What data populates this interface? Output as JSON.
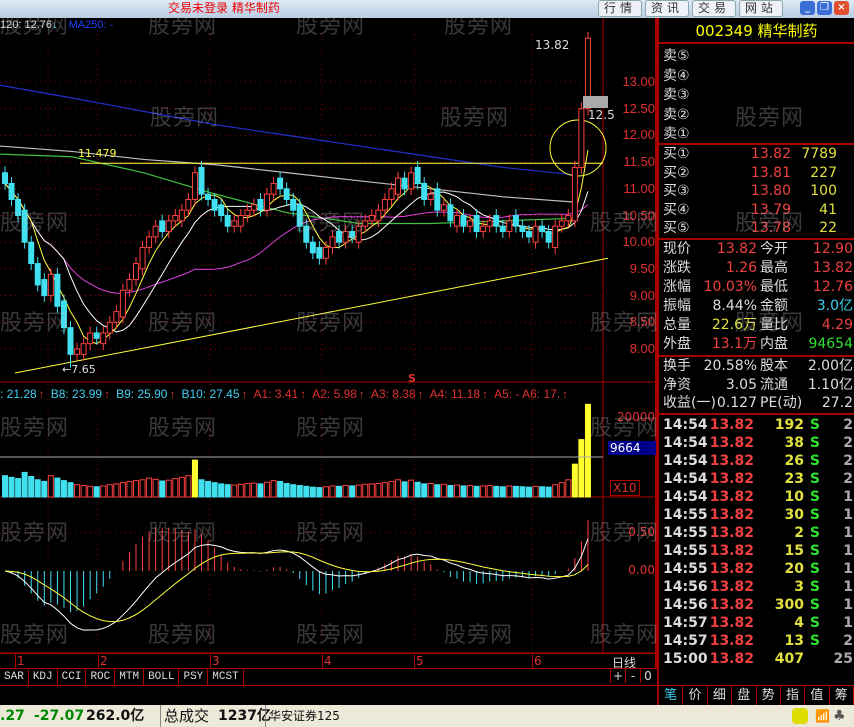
{
  "window": {
    "title": "交易未登录 精华制药",
    "nav_buttons": [
      "行情",
      "资讯",
      "交易",
      "网站"
    ],
    "watermark": "股旁网"
  },
  "chart_header": {
    "ma120": "120: 12.76",
    "ma120_arrow": "↓",
    "ma250": "MA250: -"
  },
  "price_chart": {
    "y_ticks": [
      "13.00",
      "12.50",
      "12.00",
      "11.50",
      "11.00",
      "10.50",
      "10.00",
      "9.50",
      "9.00",
      "8.50",
      "8.00"
    ],
    "high_label": "13.82",
    "low_label": "←7.65",
    "line_label": "11.479",
    "cursor_label": "12.5",
    "colors": {
      "up": "#ff4040",
      "down": "#40e0f0",
      "ma5": "#ffff40",
      "ma10": "#ffffff",
      "ma30": "#e040e0",
      "ma60": "#40c040",
      "ma120": "#c0c0c0",
      "ma250": "#2030d0"
    }
  },
  "chart_data": {
    "type": "candlestick",
    "close": [
      11.1,
      10.8,
      10.5,
      10.0,
      9.6,
      9.2,
      9.0,
      9.4,
      8.8,
      8.4,
      7.9,
      8.0,
      8.1,
      8.3,
      8.2,
      8.3,
      8.5,
      8.7,
      9.1,
      9.3,
      9.6,
      9.9,
      10.1,
      10.3,
      10.2,
      10.4,
      10.5,
      10.6,
      10.8,
      11.3,
      10.9,
      10.8,
      10.6,
      10.5,
      10.3,
      10.4,
      10.5,
      10.6,
      10.7,
      10.6,
      10.9,
      11.1,
      11.0,
      10.8,
      10.6,
      10.3,
      10.0,
      9.8,
      9.7,
      9.9,
      10.1,
      10.0,
      10.2,
      10.1,
      10.3,
      10.4,
      10.5,
      10.6,
      10.8,
      11.0,
      11.2,
      11.0,
      11.3,
      11.1,
      10.8,
      10.9,
      10.6,
      10.7,
      10.4,
      10.5,
      10.3,
      10.4,
      10.2,
      10.3,
      10.4,
      10.3,
      10.2,
      10.4,
      10.3,
      10.2,
      10.1,
      10.3,
      10.2,
      10.0,
      10.3,
      10.4,
      10.5,
      11.4,
      12.5,
      13.82
    ],
    "volume": [
      5200,
      4800,
      4500,
      6000,
      5000,
      4200,
      3800,
      5200,
      4600,
      4000,
      3500,
      3000,
      2800,
      2600,
      2500,
      2700,
      3000,
      3200,
      3500,
      3800,
      4000,
      4200,
      4600,
      4300,
      3900,
      4100,
      4500,
      4800,
      5200,
      9000,
      4200,
      3800,
      3500,
      3200,
      3000,
      2900,
      3100,
      3300,
      3400,
      3200,
      3600,
      4000,
      3800,
      3300,
      3000,
      2800,
      2600,
      2400,
      2300,
      2500,
      2700,
      2600,
      2800,
      2700,
      2900,
      3100,
      3200,
      3300,
      3500,
      3800,
      4200,
      3700,
      4100,
      3600,
      3200,
      3300,
      3000,
      3100,
      2800,
      2900,
      2700,
      2800,
      2600,
      2700,
      2800,
      2600,
      2500,
      2700,
      2600,
      2500,
      2400,
      2600,
      2500,
      2400,
      3000,
      3500,
      4200,
      8000,
      14000,
      22600
    ],
    "ma120_line": [
      11.8,
      11.7,
      11.55,
      11.45,
      11.3,
      11.15,
      11.0,
      10.85,
      10.75
    ],
    "ma60_line": [
      11.65,
      11.6,
      11.3,
      10.9,
      10.55,
      10.35,
      10.35,
      10.4,
      10.45
    ],
    "ma250_line": [
      12.94,
      12.7,
      12.45,
      12.2,
      12.0,
      11.8,
      11.6,
      11.4,
      11.26
    ],
    "x_ticks": [
      "1",
      "2",
      "3",
      "4",
      "5",
      "6"
    ],
    "period": "日线"
  },
  "volume_panel": {
    "y_tick": "20000",
    "ma_value": "9664",
    "multiplier": "X10"
  },
  "macd_panel": {
    "y_ticks": [
      "0.50",
      "0.00"
    ]
  },
  "pattern_bar": {
    "items": [
      {
        "t": ": 21.28",
        "c": "#40d0f0"
      },
      {
        "t": "B8: 23.99",
        "c": "#40d0f0"
      },
      {
        "t": "B9: 25.90",
        "c": "#40d0f0"
      },
      {
        "t": "B10: 27.45",
        "c": "#40d0f0"
      },
      {
        "t": "A1: 3.41",
        "c": "#e03030"
      },
      {
        "t": "A2: 5.98",
        "c": "#e03030"
      },
      {
        "t": "A3: 8.38",
        "c": "#e03030"
      },
      {
        "t": "A4: 11.18",
        "c": "#e03030"
      },
      {
        "t": "A5: - A6: 17.",
        "c": "#e03030"
      }
    ],
    "marker": "S"
  },
  "indicator_tabs": [
    "SAR",
    "KDJ",
    "CCI",
    "ROC",
    "MTM",
    "BOLL",
    "PSY",
    "MCST"
  ],
  "zoom_controls": [
    "+",
    "-",
    "0"
  ],
  "quote": {
    "code_name": "002349 精华制药",
    "sell": [
      {
        "label": "卖⑤"
      },
      {
        "label": "卖④"
      },
      {
        "label": "卖③"
      },
      {
        "label": "卖②"
      },
      {
        "label": "卖①"
      }
    ],
    "buy": [
      {
        "label": "买①",
        "price": "13.82",
        "vol": "7789"
      },
      {
        "label": "买②",
        "price": "13.81",
        "vol": "227"
      },
      {
        "label": "买③",
        "price": "13.80",
        "vol": "100"
      },
      {
        "label": "买④",
        "price": "13.79",
        "vol": "41"
      },
      {
        "label": "买⑤",
        "price": "13.78",
        "vol": "22"
      }
    ],
    "stats": [
      {
        "l1": "现价",
        "v1": "13.82",
        "c1": "red",
        "l2": "今开",
        "v2": "12.90",
        "c2": "red"
      },
      {
        "l1": "涨跌",
        "v1": "1.26",
        "c1": "red",
        "l2": "最高",
        "v2": "13.82",
        "c2": "red"
      },
      {
        "l1": "涨幅",
        "v1": "10.03%",
        "c1": "red",
        "l2": "最低",
        "v2": "12.76",
        "c2": "red"
      },
      {
        "l1": "振幅",
        "v1": "8.44%",
        "c1": "wht",
        "l2": "金额",
        "v2": "3.0亿",
        "c2": "cyan"
      },
      {
        "l1": "总量",
        "v1": "22.6万",
        "c1": "yel",
        "l2": "量比",
        "v2": "4.29",
        "c2": "red"
      },
      {
        "l1": "外盘",
        "v1": "13.1万",
        "c1": "red",
        "l2": "内盘",
        "v2": "94654",
        "c2": "grn"
      }
    ],
    "fund": [
      {
        "l1": "换手",
        "v1": "20.58%",
        "l2": "股本",
        "v2": "2.00亿"
      },
      {
        "l1": "净资",
        "v1": "3.05",
        "l2": "流通",
        "v2": "1.10亿"
      },
      {
        "l1": "收益(一)",
        "v1": "0.127",
        "l2": "PE(动)",
        "v2": "27.2"
      }
    ],
    "trades": [
      {
        "t": "14:54",
        "p": "13.82",
        "v": "192",
        "s": "S",
        "n": "2"
      },
      {
        "t": "14:54",
        "p": "13.82",
        "v": "38",
        "s": "S",
        "n": "2"
      },
      {
        "t": "14:54",
        "p": "13.82",
        "v": "26",
        "s": "S",
        "n": "2"
      },
      {
        "t": "14:54",
        "p": "13.82",
        "v": "23",
        "s": "S",
        "n": "2"
      },
      {
        "t": "14:54",
        "p": "13.82",
        "v": "10",
        "s": "S",
        "n": "1"
      },
      {
        "t": "14:55",
        "p": "13.82",
        "v": "30",
        "s": "S",
        "n": "1"
      },
      {
        "t": "14:55",
        "p": "13.82",
        "v": "2",
        "s": "S",
        "n": "1"
      },
      {
        "t": "14:55",
        "p": "13.82",
        "v": "15",
        "s": "S",
        "n": "1"
      },
      {
        "t": "14:55",
        "p": "13.82",
        "v": "20",
        "s": "S",
        "n": "1"
      },
      {
        "t": "14:56",
        "p": "13.82",
        "v": "3",
        "s": "S",
        "n": "1"
      },
      {
        "t": "14:56",
        "p": "13.82",
        "v": "300",
        "s": "S",
        "n": "1"
      },
      {
        "t": "14:57",
        "p": "13.82",
        "v": "4",
        "s": "S",
        "n": "1"
      },
      {
        "t": "14:57",
        "p": "13.82",
        "v": "13",
        "s": "S",
        "n": "2"
      },
      {
        "t": "15:00",
        "p": "13.82",
        "v": "407",
        "s": "",
        "n": "25"
      }
    ],
    "tabs": [
      "笔",
      "价",
      "细",
      "盘",
      "势",
      "指",
      "值",
      "筹"
    ]
  },
  "status": {
    "v1": ".27",
    "v2": "-27.07",
    "v3": "262.0亿",
    "total_label": "总成交",
    "total": "1237亿",
    "broker": "华安证券125"
  }
}
